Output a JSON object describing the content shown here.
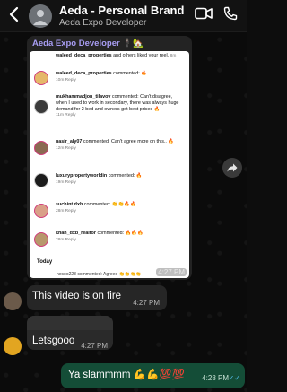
{
  "header": {
    "back_icon": "chevron-left-icon",
    "title": "Aeda - Personal Brand",
    "subtitle": "Aeda Expo Developer",
    "video_icon": "video-call-icon",
    "phone_icon": "phone-icon"
  },
  "forwarded_card": {
    "title": "Aeda Expo Developer 🕴🏻🏡",
    "time": "4:27 PM",
    "screenshot": {
      "rows": [
        {
          "user": "waleed_deca_properties",
          "text": " and others liked your reel. ",
          "meta": "8m"
        },
        {
          "user": "waleed_deca_properties",
          "text": " commented: 🔥",
          "meta": "10m   Reply"
        },
        {
          "user": "mukhammadjon_tilavov",
          "text": " commented: Can't disagree, when I used to work in secondary, there was always huge demand for 2 bed and owners got best prices 🔥",
          "meta": "11m   Reply"
        },
        {
          "user": "nasir_aly07",
          "text": " commented: Can't agree more on this.. 🔥",
          "meta": "12m   Reply"
        },
        {
          "user": "luxurypropertyworldin",
          "text": " commented: 🔥",
          "meta": "19m   Reply"
        },
        {
          "user": "suchint.dxb",
          "text": " commented: 👏👏🔥🔥",
          "meta": "28m   Reply"
        },
        {
          "user": "khan_dxb_realtor",
          "text": " commented: 🔥🔥🔥",
          "meta": "28m   Reply"
        }
      ],
      "section_label": "Today",
      "last_row": "nesoo228 commented: Agreed 👏👏👏👏"
    }
  },
  "messages": [
    {
      "text": "This video is on fire",
      "time": "4:27 PM"
    },
    {
      "text": "Letsgooo",
      "time": "4:27 PM"
    },
    {
      "text": "Ya slammmm 💪💪💯💯",
      "time": "4:28 PM",
      "status": "✓✓"
    }
  ],
  "colors": {
    "accent_purple": "#a79cf2",
    "outgoing_bubble": "#144d37",
    "incoming_bubble": "#262626"
  }
}
